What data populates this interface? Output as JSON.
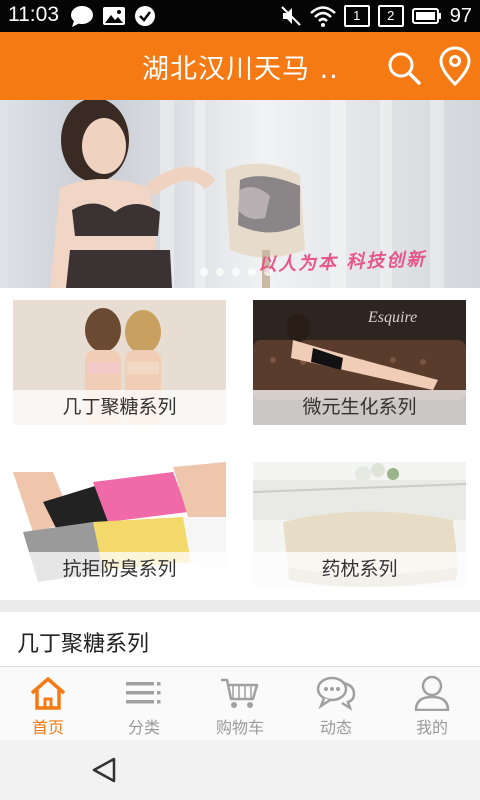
{
  "status_bar": {
    "time": "11:03",
    "sim1": "1",
    "sim2": "2",
    "battery": "97"
  },
  "header": {
    "title": "湖北汉川天马 .."
  },
  "banner": {
    "slogan": "以人为本  科技创新",
    "slide_count": 5
  },
  "categories": [
    {
      "label": "几丁聚糖系列"
    },
    {
      "label": "微元生化系列"
    },
    {
      "label": "抗拒防臭系列"
    },
    {
      "label": "药枕系列"
    }
  ],
  "section": {
    "title": "几丁聚糖系列"
  },
  "bottom_nav": [
    {
      "label": "首页",
      "active": true,
      "icon": "home-icon"
    },
    {
      "label": "分类",
      "active": false,
      "icon": "list-icon"
    },
    {
      "label": "购物车",
      "active": false,
      "icon": "cart-icon"
    },
    {
      "label": "动态",
      "active": false,
      "icon": "chat-icon"
    },
    {
      "label": "我的",
      "active": false,
      "icon": "user-icon"
    }
  ],
  "colors": {
    "accent": "#f57a14",
    "inactive": "#9a9a9a"
  }
}
